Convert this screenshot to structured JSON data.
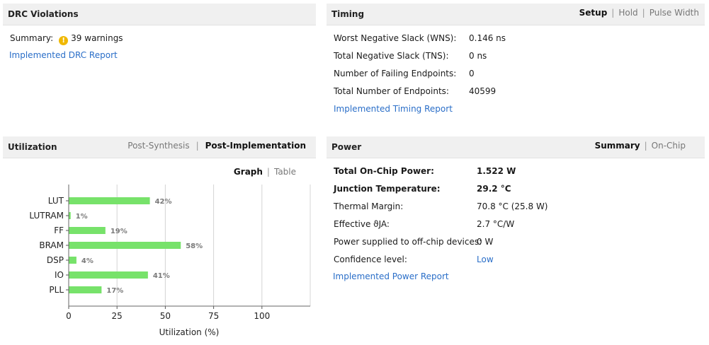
{
  "drc": {
    "title": "DRC Violations",
    "summary_label": "Summary:",
    "warnings_text": "39 warnings",
    "report_link": "Implemented DRC Report"
  },
  "timing": {
    "title": "Timing",
    "tabs": [
      "Setup",
      "Hold",
      "Pulse Width"
    ],
    "selected_tab": "Setup",
    "rows": [
      {
        "label": "Worst Negative Slack (WNS):",
        "value": "0.146 ns"
      },
      {
        "label": "Total Negative Slack (TNS):",
        "value": "0 ns"
      },
      {
        "label": "Number of Failing Endpoints:",
        "value": "0"
      },
      {
        "label": "Total Number of Endpoints:",
        "value": "40599"
      }
    ],
    "report_link": "Implemented Timing Report"
  },
  "utilization": {
    "title": "Utilization",
    "tabs": [
      "Post-Synthesis",
      "Post-Implementation"
    ],
    "selected_tab": "Post-Implementation",
    "view_tabs": [
      "Graph",
      "Table"
    ],
    "selected_view": "Graph"
  },
  "power": {
    "title": "Power",
    "tabs": [
      "Summary",
      "On-Chip"
    ],
    "selected_tab": "Summary",
    "rows": [
      {
        "label": "Total On-Chip Power:",
        "value": "1.522 W"
      },
      {
        "label": "Junction Temperature:",
        "value": "29.2 °C"
      },
      {
        "label": "Thermal Margin:",
        "value": "70.8 °C (25.8 W)"
      },
      {
        "label": "Effective ϑJA:",
        "value": "2.7 °C/W"
      },
      {
        "label": "Power supplied to off-chip devices:",
        "value": "0 W"
      },
      {
        "label": "Confidence level:",
        "value": "Low"
      }
    ],
    "report_link": "Implemented Power Report"
  },
  "colors": {
    "bar": "#77e26a",
    "link": "#2a6ec8",
    "warning": "#f0b800"
  },
  "chart_data": {
    "type": "bar",
    "orientation": "horizontal",
    "categories": [
      "LUT",
      "LUTRAM",
      "FF",
      "BRAM",
      "DSP",
      "IO",
      "PLL"
    ],
    "values": [
      42,
      1,
      19,
      58,
      4,
      41,
      17
    ],
    "value_labels": [
      "42%",
      "1%",
      "19%",
      "58%",
      "4%",
      "41%",
      "17%"
    ],
    "xlabel": "Utilization (%)",
    "xlim": [
      0,
      125
    ],
    "xticks": [
      0,
      25,
      50,
      75,
      100
    ],
    "grid": true
  }
}
